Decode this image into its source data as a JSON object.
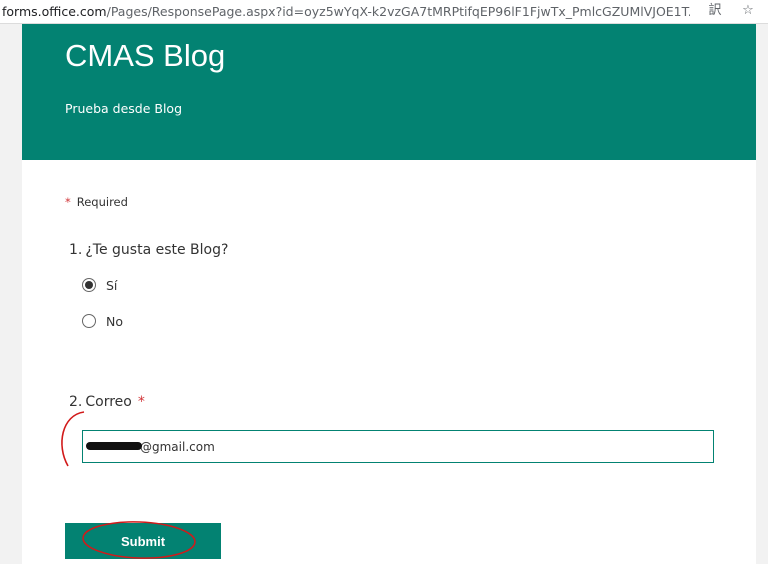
{
  "browser": {
    "url_host": "forms.office.com",
    "url_path": "/Pages/ResponsePage.aspx?id=oyz5wYqX-k2vzGA7tMRPtifqEP96lF1FjwTx_PmlcGZUMlVJOE1T...",
    "translate_icon": "translate-icon",
    "star_icon": "star-icon"
  },
  "form": {
    "title": "CMAS Blog",
    "subtitle": "Prueba desde Blog",
    "required_star": "*",
    "required_label": "Required",
    "header_color": "#038272"
  },
  "questions": [
    {
      "number": "1.",
      "text": "¿Te gusta este Blog?",
      "options": [
        {
          "label": "Sí",
          "selected": true
        },
        {
          "label": "No",
          "selected": false
        }
      ]
    },
    {
      "number": "2.",
      "text": "Correo",
      "required_star": "*",
      "value": "@gmail.com"
    }
  ],
  "submit": {
    "label": "Submit"
  },
  "annotation_color": "#d11a1a"
}
